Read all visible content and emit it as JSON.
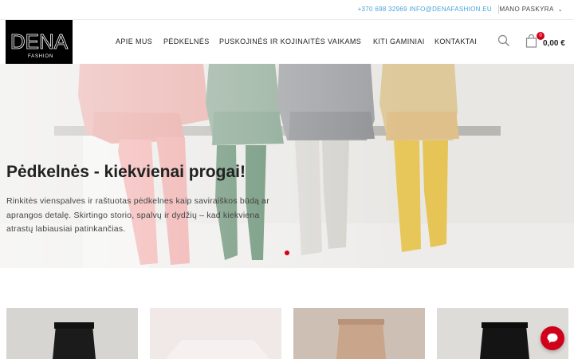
{
  "topbar": {
    "phone": "+370 698 32969",
    "email": "INFO@DENAFASHION.EU",
    "account_label": "MANO PASKYRA"
  },
  "logo": {
    "brand": "DENA",
    "tagline": "FASHION"
  },
  "nav": {
    "items": [
      "APIE MUS",
      "PĖDKELNĖS",
      "PUSKOJINĖS IR KOJINAITĖS",
      "VAIKAMS",
      "KITI GAMINIAI",
      "KONTAKTAI"
    ]
  },
  "cart": {
    "count": "0",
    "total": "0,00 €"
  },
  "hero": {
    "title": "Pėdkelnės - kiekvienai progai!",
    "text": "Rinkitės vienspalves ir raštuotas pėdkelnes kaip saviraiškos būdą ar aprangos detalę. Skirtingo storio, spalvų ir dydžių – kad kiekviena atrastų labiausiai patinkančias.",
    "active_slide": 1
  },
  "colors": {
    "accent": "#d0021b",
    "link": "#4aa3d8"
  }
}
